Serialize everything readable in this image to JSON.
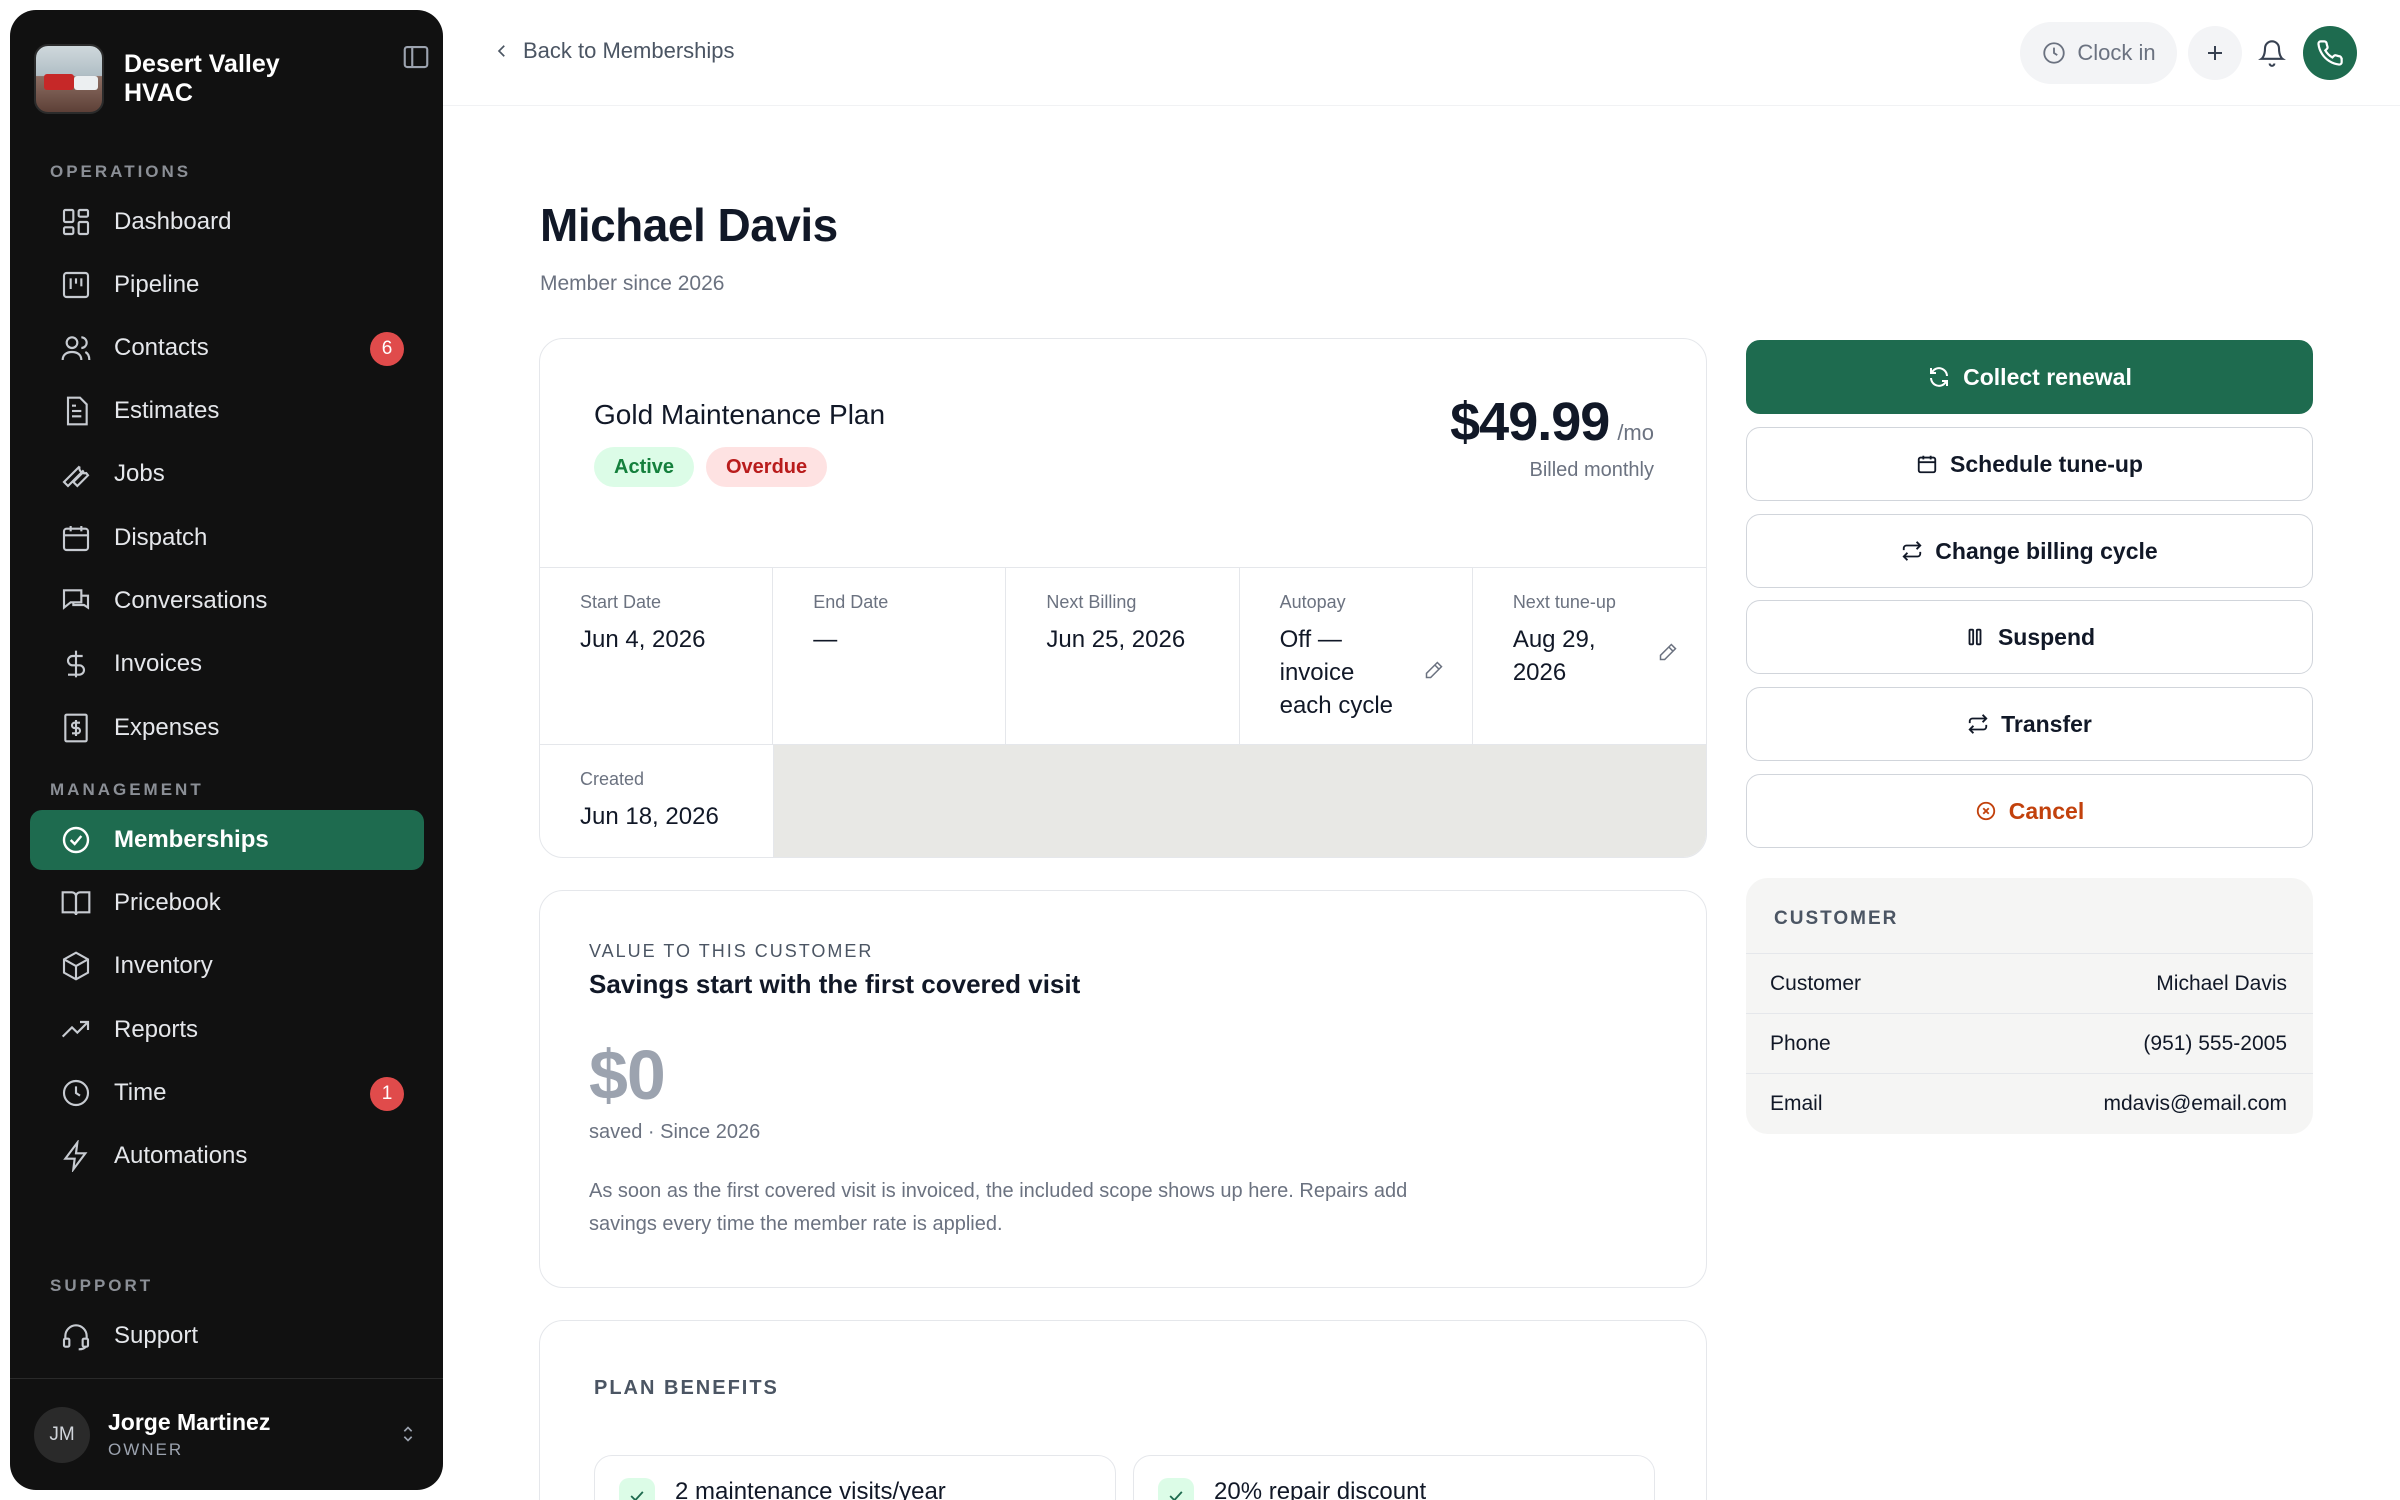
{
  "brand": {
    "name": "Desert Valley HVAC"
  },
  "sidebar": {
    "sections": {
      "operations": "OPERATIONS",
      "management": "MANAGEMENT",
      "support": "SUPPORT"
    },
    "items": [
      {
        "label": "Dashboard",
        "icon": "dashboard-icon"
      },
      {
        "label": "Pipeline",
        "icon": "pipeline-icon"
      },
      {
        "label": "Contacts",
        "icon": "contacts-icon",
        "badge": "6"
      },
      {
        "label": "Estimates",
        "icon": "estimates-icon"
      },
      {
        "label": "Jobs",
        "icon": "wrench-icon"
      },
      {
        "label": "Dispatch",
        "icon": "calendar-icon"
      },
      {
        "label": "Conversations",
        "icon": "chat-icon"
      },
      {
        "label": "Invoices",
        "icon": "dollar-icon"
      },
      {
        "label": "Expenses",
        "icon": "receipt-icon"
      },
      {
        "label": "Memberships",
        "icon": "check-circle-icon",
        "active": true
      },
      {
        "label": "Pricebook",
        "icon": "book-icon"
      },
      {
        "label": "Inventory",
        "icon": "box-icon"
      },
      {
        "label": "Reports",
        "icon": "trend-icon"
      },
      {
        "label": "Time",
        "icon": "clock-icon",
        "badge": "1"
      },
      {
        "label": "Automations",
        "icon": "bolt-icon"
      },
      {
        "label": "Support",
        "icon": "headset-icon"
      }
    ],
    "user": {
      "initials": "JM",
      "name": "Jorge Martinez",
      "role": "OWNER"
    }
  },
  "topbar": {
    "back_label": "Back to Memberships",
    "clock_label": "Clock in"
  },
  "header": {
    "title": "Michael Davis",
    "subtitle": "Member since 2026"
  },
  "plan": {
    "name": "Gold Maintenance Plan",
    "status_active": "Active",
    "status_overdue": "Overdue",
    "price": "$49.99",
    "price_unit": "/mo",
    "billed": "Billed monthly",
    "fields": {
      "start_label": "Start Date",
      "start_value": "Jun 4, 2026",
      "end_label": "End Date",
      "end_value": "—",
      "next_billing_label": "Next Billing",
      "next_billing_value": "Jun 25, 2026",
      "autopay_label": "Autopay",
      "autopay_value": "Off — invoice each cycle",
      "next_tuneup_label": "Next tune-up",
      "next_tuneup_value": "Aug 29, 2026",
      "created_label": "Created",
      "created_value": "Jun 18, 2026"
    }
  },
  "value": {
    "kicker": "VALUE TO THIS CUSTOMER",
    "title": "Savings start with the first covered visit",
    "amount": "$0",
    "saved": "saved · Since 2026",
    "description": "As soon as the first covered visit is invoiced, the included scope shows up here. Repairs add savings every time the member rate is applied."
  },
  "benefits": {
    "title": "PLAN BENEFITS",
    "items": [
      "2 maintenance visits/year",
      "20% repair discount"
    ]
  },
  "actions": {
    "collect": "Collect renewal",
    "schedule": "Schedule tune-up",
    "change_cycle": "Change billing cycle",
    "suspend": "Suspend",
    "transfer": "Transfer",
    "cancel": "Cancel"
  },
  "customer": {
    "title": "CUSTOMER",
    "rows": [
      {
        "label": "Customer",
        "value": "Michael Davis"
      },
      {
        "label": "Phone",
        "value": "(951) 555-2005"
      },
      {
        "label": "Email",
        "value": "mdavis@email.com"
      }
    ]
  },
  "colors": {
    "brand_green": "#1e6b4f",
    "sidebar_bg": "#111111",
    "badge_red": "#e04b4b",
    "cancel_orange": "#c2410c"
  }
}
